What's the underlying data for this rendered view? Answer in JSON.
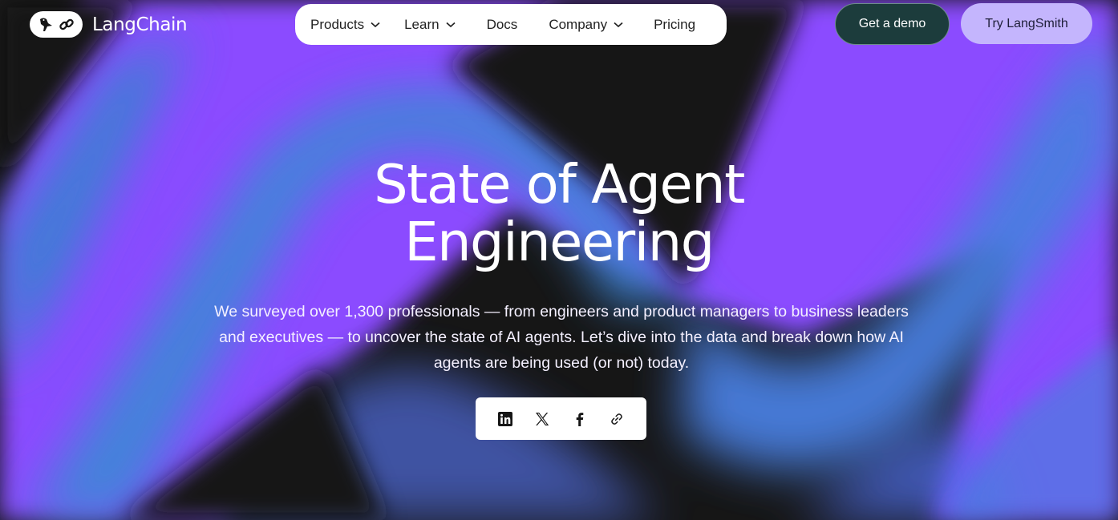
{
  "brand": {
    "name": "LangChain"
  },
  "nav": {
    "items": [
      {
        "label": "Products",
        "has_dropdown": true
      },
      {
        "label": "Learn",
        "has_dropdown": true
      },
      {
        "label": "Docs",
        "has_dropdown": false
      },
      {
        "label": "Company",
        "has_dropdown": true
      },
      {
        "label": "Pricing",
        "has_dropdown": false
      }
    ]
  },
  "actions": {
    "demo_label": "Get a demo",
    "try_label": "Try LangSmith"
  },
  "hero": {
    "title_line1": "State of Agent",
    "title_line2": "Engineering",
    "subtitle": "We surveyed over 1,300 professionals — from engineers and product managers to business leaders and executives — to uncover the state of AI agents. Let’s dive into the data and break down how AI agents are being used (or not) today."
  },
  "share": {
    "icons": [
      "linkedin-icon",
      "x-icon",
      "facebook-icon",
      "link-icon"
    ]
  },
  "colors": {
    "background": "#161616",
    "purple": "#8f4cff",
    "blue": "#3f86d8",
    "demo_button": "#1c3c3c",
    "try_button": "#c4b5fd"
  }
}
